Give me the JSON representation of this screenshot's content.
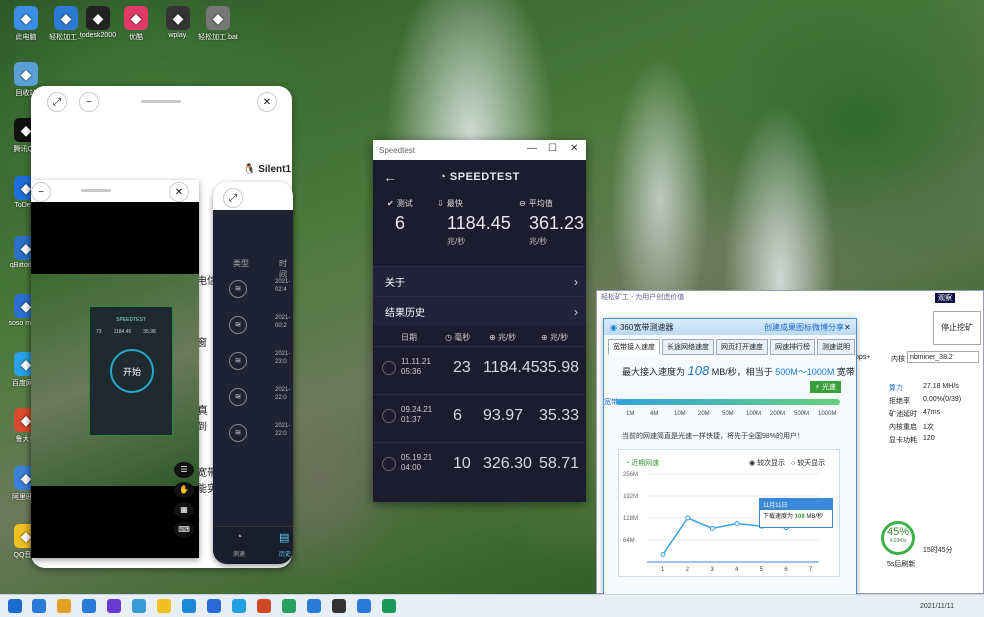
{
  "desktop": {
    "icons": [
      {
        "label": "此电脑",
        "icon": "computer-icon",
        "color": "#3a8ee6"
      },
      {
        "label": "轻松加工...",
        "icon": "globe-icon",
        "color": "#2b7bd6"
      },
      {
        "label": "todesk2000",
        "icon": "fox-icon",
        "color": "#222222"
      },
      {
        "label": "优酷",
        "icon": "youku-icon",
        "color": "#e03a6a"
      },
      {
        "label": "wplay.",
        "icon": "phone-icon",
        "color": "#333333"
      },
      {
        "label": "轻松加工.bat",
        "icon": "gear-icon",
        "color": "#777777"
      },
      {
        "label": "回收站",
        "icon": "recycle-bin-icon",
        "color": "#5aa0d8"
      },
      {
        "label": "腾讯QQ",
        "icon": "qq-icon",
        "color": "#111111"
      },
      {
        "label": "ToDesk",
        "icon": "todesk-icon",
        "color": "#1e6fd9"
      },
      {
        "label": "qBittorrent",
        "icon": "qbittorrent-icon",
        "color": "#2a70c6"
      },
      {
        "label": "soso music",
        "icon": "headphones-icon",
        "color": "#2c6fd2"
      },
      {
        "label": "百度网盘",
        "icon": "cloud-icon",
        "color": "#2aa0e6"
      },
      {
        "label": "鲁大师",
        "icon": "ludashi-icon",
        "color": "#d94a2a"
      },
      {
        "label": "阿里旺旺",
        "icon": "wangwang-icon",
        "color": "#3a7fd9"
      },
      {
        "label": "QQ音乐",
        "icon": "music-icon",
        "color": "#f0c020"
      }
    ]
  },
  "phone_left": {
    "side_buttons": [
      "⤢",
      "−",
      "✕"
    ],
    "small_buttons": [
      "−",
      "✕"
    ],
    "text_frag1": "电信",
    "text_frag2": "窗",
    "text_frag3": "真",
    "text_frag4": "到",
    "text_frag5": "宽带",
    "text_frag6": "能实",
    "silent_label": "Silent1",
    "mini_speedtest": {
      "title": "SPEEDTEST",
      "start": "开始",
      "v1": "73",
      "v2": "1184.45",
      "v3": "35.98"
    }
  },
  "phone_mid": {
    "col_type": "类型",
    "col_time": "时间",
    "rows": [
      {
        "d": "2021-",
        "t": "02:4"
      },
      {
        "d": "2021-",
        "t": "00:2"
      },
      {
        "d": "2021-",
        "t": "23:0"
      },
      {
        "d": "2021-",
        "t": "22:0"
      },
      {
        "d": "2021-",
        "t": "22:0"
      }
    ],
    "nav": [
      {
        "label": "测速",
        "icon": "speedometer-icon"
      },
      {
        "label": "历史",
        "icon": "history-icon"
      }
    ]
  },
  "speedtest": {
    "window_title": "Speedtest",
    "logo": "SPEEDTEST",
    "tests_label": "测试",
    "tests_value": "6",
    "best_label": "最快",
    "best_value": "1184.45",
    "best_unit": "兆/秒",
    "avg_label": "平均值",
    "avg_value": "361.23",
    "avg_unit": "兆/秒",
    "about": "关于",
    "history": "结果历史",
    "col_date": "日期",
    "col_ping": "毫秒",
    "col_down": "兆/秒",
    "col_up": "兆/秒",
    "rows": [
      {
        "date": "11.11.21",
        "time": "05:36",
        "ping": "23",
        "down": "1184.45",
        "up": "35.98"
      },
      {
        "date": "09.24.21",
        "time": "01:37",
        "ping": "6",
        "down": "93.97",
        "up": "35.33"
      },
      {
        "date": "05.19.21",
        "time": "04:00",
        "ping": "10",
        "down": "326.30",
        "up": "58.71"
      }
    ]
  },
  "miner": {
    "title": "轻松矿工 - 为用户创造价值",
    "stop_btn": "停止挖矿",
    "tag": "观察",
    "kernel_label": "内核",
    "kernel_value": "nbminer_38.2",
    "ops_value": "ops+",
    "stats": [
      {
        "k": "算力",
        "v": "27.18 MH/s"
      },
      {
        "k": "拒绝率",
        "v": "0.00%(0/39)"
      },
      {
        "k": "矿池延时",
        "v": "47ms"
      },
      {
        "k": "内核重启",
        "v": "1次"
      },
      {
        "k": "显卡功耗",
        "v": "120"
      }
    ],
    "gauge_pct": "45%",
    "gauge_sub": "4.03K/s",
    "gauge_foot": "5s后刷新",
    "time_frag": "15时45分"
  },
  "bb360": {
    "title": "360宽带测速器",
    "links": [
      "创建成果图标",
      "微博分享"
    ],
    "tabs": [
      "宽带接入速度",
      "长途网络速度",
      "网页打开速度",
      "网速排行榜",
      "测速说明"
    ],
    "max_label": "最大接入速度为",
    "max_value": "108",
    "max_unit": "MB/秒，相当于",
    "range": "500M～1000M",
    "range_suffix": "宽带",
    "badge": "光速",
    "scale_label": "宽带",
    "ticks": [
      "1M",
      "4M",
      "10M",
      "20M",
      "50M",
      "100M",
      "200M",
      "500M",
      "1000M"
    ],
    "note": "当前的网速简直是光速一样快捷，将先于全国98%的用户！",
    "chart_title": "近期网速",
    "legend_a": "较次显示",
    "legend_b": "较天显示",
    "tooltip_date": "11月11日",
    "tooltip_text": "下载速度为",
    "tooltip_value": "108",
    "tooltip_unit": "MB/秒"
  },
  "chart_data": {
    "type": "line",
    "title": "近期网速",
    "x": [
      1,
      2,
      3,
      4,
      5,
      6,
      7
    ],
    "yticks": [
      "256M",
      "192M",
      "128M",
      "64M"
    ],
    "series": [
      {
        "values": [
          22,
          128,
          98,
          112,
          104,
          100,
          108
        ]
      }
    ],
    "ylim": [
      0,
      256
    ]
  },
  "taskbar": {
    "clock": "2021/11/11",
    "colors": [
      "#2a7ad8",
      "#e0a020",
      "#2a7ad8",
      "#6a3ad0",
      "#3a9ad8",
      "#f0c020",
      "#1a8ad8",
      "#2a6ad8",
      "#20a0e0",
      "#d04a2a",
      "#2aa060",
      "#2a7ad8",
      "#333333",
      "#2a7ad8",
      "#1a9a5a"
    ]
  }
}
